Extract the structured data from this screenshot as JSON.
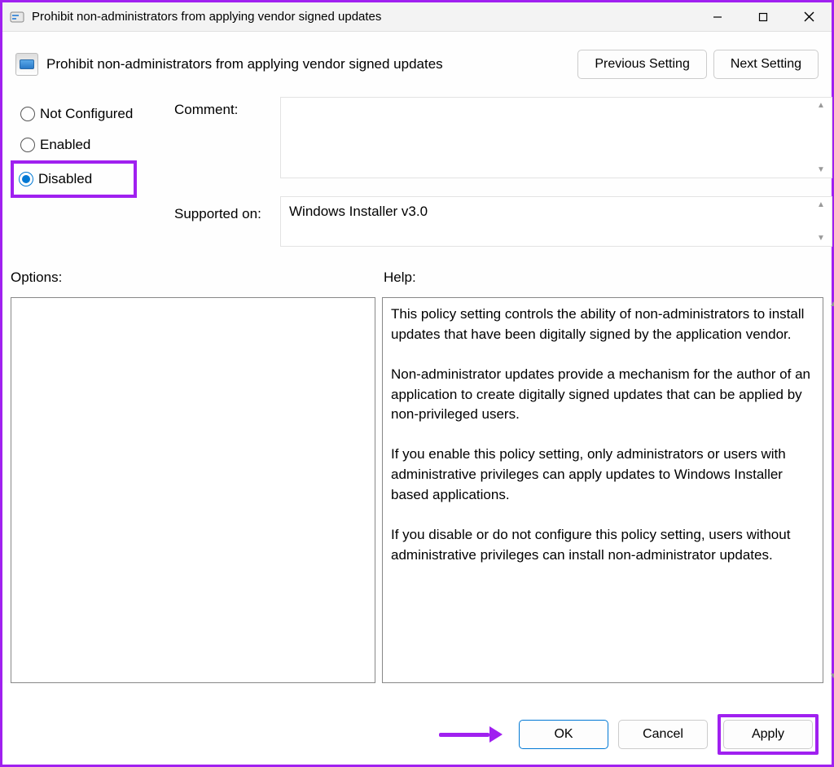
{
  "window": {
    "title": "Prohibit non-administrators from applying vendor signed updates"
  },
  "header": {
    "policy_title": "Prohibit non-administrators from applying vendor signed updates",
    "prev_btn": "Previous Setting",
    "next_btn": "Next Setting"
  },
  "radios": {
    "not_configured": "Not Configured",
    "enabled": "Enabled",
    "disabled": "Disabled",
    "selected": "disabled"
  },
  "labels": {
    "comment": "Comment:",
    "supported": "Supported on:",
    "options": "Options:",
    "help": "Help:"
  },
  "fields": {
    "comment_value": "",
    "supported_value": "Windows Installer v3.0"
  },
  "help_text": "This policy setting controls the ability of non-administrators to install updates that have been digitally signed by the application vendor.\n\nNon-administrator updates provide a mechanism for the author of an application to create digitally signed updates that can be applied by non-privileged users.\n\nIf you enable this policy setting, only administrators or users with administrative privileges can apply updates to Windows Installer based applications.\n\nIf you disable or do not configure this policy setting, users without administrative privileges can install non-administrator updates.",
  "footer": {
    "ok": "OK",
    "cancel": "Cancel",
    "apply": "Apply"
  }
}
